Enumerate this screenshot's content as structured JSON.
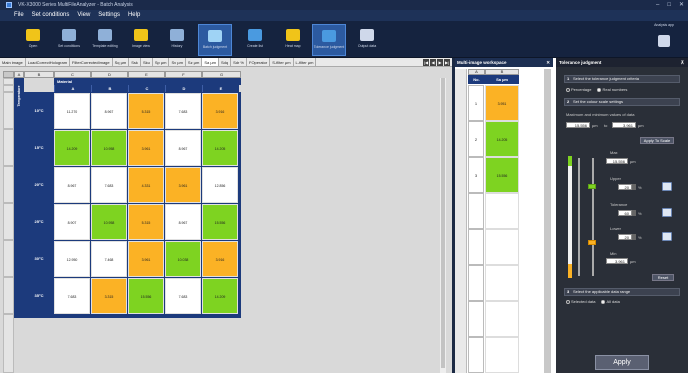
{
  "window": {
    "title": "VK-X3000 Series MultiFileAnalyzer - Batch Analysis"
  },
  "menu": [
    "File",
    "Set conditions",
    "View",
    "Settings",
    "Help"
  ],
  "toolbar": {
    "buttons": [
      {
        "label": "Open",
        "color": "#f0c419"
      },
      {
        "label": "Set conditions",
        "color": "#8fb0d8"
      },
      {
        "label": "Template editing",
        "color": "#8fb0d8"
      },
      {
        "label": "Image view",
        "color": "#f0c419"
      },
      {
        "label": "History",
        "color": "#8fb0d8"
      },
      {
        "label": "Batch judgment",
        "color": "#9fd3f5",
        "active": true
      },
      {
        "label": "Create list",
        "color": "#4a9ae0"
      },
      {
        "label": "Heat map",
        "color": "#f0c419"
      },
      {
        "label": "Tolerance judgment",
        "color": "#4a9ae0",
        "active": true
      },
      {
        "label": "Output data",
        "color": "#cfd8ea"
      }
    ],
    "analysis_app": "Analysis app"
  },
  "tabs": [
    "Main image",
    "LoadCorrectHologram",
    "FilterCorrectedImage",
    "Sq µm",
    "Ssk",
    "Sku",
    "Sp µm",
    "Sv µm",
    "Sz µm",
    "Sa µm",
    "Sdq",
    "Sdr %",
    "FOperator",
    "S-filter µm",
    "L-filter µm"
  ],
  "active_tab": "Sa µm",
  "sheet": {
    "col_letters": [
      "A",
      "B",
      "C",
      "D",
      "E",
      "F",
      "G"
    ],
    "temperature_label": "Temperature",
    "material_label": "Material",
    "materials": [
      "A",
      "B",
      "C",
      "D",
      "E"
    ],
    "rows": [
      {
        "temp": "10°C",
        "cells": [
          {
            "v": "11.270",
            "c": "w"
          },
          {
            "v": "8.967",
            "c": "w"
          },
          {
            "v": "5.315",
            "c": "o"
          },
          {
            "v": "7.683",
            "c": "w"
          },
          {
            "v": "3.916",
            "c": "o"
          }
        ]
      },
      {
        "temp": "15°C",
        "cells": [
          {
            "v": "14.209",
            "c": "g"
          },
          {
            "v": "10.958",
            "c": "g"
          },
          {
            "v": "3.961",
            "c": "o"
          },
          {
            "v": "8.967",
            "c": "w"
          },
          {
            "v": "14.205",
            "c": "g"
          }
        ]
      },
      {
        "temp": "20°C",
        "cells": [
          {
            "v": "8.967",
            "c": "w"
          },
          {
            "v": "7.683",
            "c": "w"
          },
          {
            "v": "4.331",
            "c": "o"
          },
          {
            "v": "3.961",
            "c": "o"
          },
          {
            "v": "12.856",
            "c": "w"
          }
        ]
      },
      {
        "temp": "25°C",
        "cells": [
          {
            "v": "8.907",
            "c": "w"
          },
          {
            "v": "10.958",
            "c": "g"
          },
          {
            "v": "5.315",
            "c": "o"
          },
          {
            "v": "8.967",
            "c": "w"
          },
          {
            "v": "15.556",
            "c": "g"
          }
        ]
      },
      {
        "temp": "30°C",
        "cells": [
          {
            "v": "12.950",
            "c": "w"
          },
          {
            "v": "7.468",
            "c": "w"
          },
          {
            "v": "3.961",
            "c": "o"
          },
          {
            "v": "10.038",
            "c": "g"
          },
          {
            "v": "3.916",
            "c": "o"
          }
        ]
      },
      {
        "temp": "35°C",
        "cells": [
          {
            "v": "7.683",
            "c": "w"
          },
          {
            "v": "3.315",
            "c": "o"
          },
          {
            "v": "15.556",
            "c": "g"
          },
          {
            "v": "7.683",
            "c": "w"
          },
          {
            "v": "14.209",
            "c": "g"
          }
        ]
      }
    ]
  },
  "workspace": {
    "title": "Multi-image workspace",
    "col_letters": [
      "A",
      "B"
    ],
    "headers": [
      "No.",
      "Sa µm"
    ],
    "rows": [
      {
        "no": "1",
        "v": "3.951",
        "c": "o"
      },
      {
        "no": "2",
        "v": "14.205",
        "c": "g"
      },
      {
        "no": "3",
        "v": "15.556",
        "c": "g"
      }
    ]
  },
  "tolerance": {
    "title": "Tolerance judgment",
    "step1": "Select the tolerance judgment criteria",
    "opt_percentage": "Percentage",
    "opt_real": "Real numbers",
    "step2": "Set the colour scale settings",
    "max_min_label": "Maximum and minimum values of data",
    "min_val": "15.556",
    "max_val": "3.961",
    "unit": "µm",
    "to": "to",
    "apply_to_scale": "Apply To Scale",
    "max_label": "Max",
    "max_value": "15.556",
    "upper_label": "Upper",
    "upper_value": "20",
    "tolerance_label": "Tolerance",
    "tolerance_value": "60",
    "lower_label": "Lower",
    "lower_value": "20",
    "min_label": "Min",
    "min_value": "3.961",
    "pct": "%",
    "reset": "Reset",
    "step3": "Select the applicable data range",
    "opt_selected": "Selected data",
    "opt_all": "All data",
    "apply": "Apply"
  }
}
